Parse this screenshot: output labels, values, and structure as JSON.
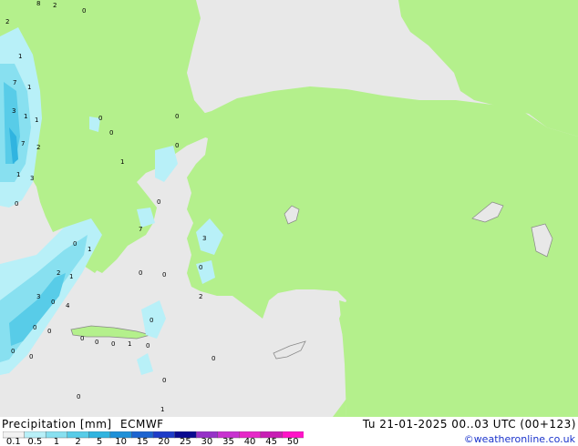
{
  "header": {
    "title": "Precipitation [mm]",
    "model": "ECMWF",
    "valid": "Tu 21-01-2025 00..03 UTC (00+123)"
  },
  "credit": "©weatheronline.co.uk",
  "legend": {
    "ticks": [
      "0.1",
      "0.5",
      "1",
      "2",
      "5",
      "10",
      "15",
      "20",
      "25",
      "30",
      "35",
      "40",
      "45",
      "50"
    ],
    "colors": [
      "#f2f2f2",
      "#b8f0f8",
      "#88e0f0",
      "#58cce8",
      "#30b4e0",
      "#1e90d8",
      "#1c64d0",
      "#1e3cc8",
      "#0a0a90",
      "#9632c8",
      "#c832d0",
      "#e628c8",
      "#c81eb4",
      "#ff14c8"
    ]
  },
  "map": {
    "colors": {
      "sea": "#e8e8e8",
      "land": "#b4f08c",
      "drizzle": "#b8f0f8",
      "light": "#88e0f0",
      "moderate": "#58cce8",
      "heavy": "#30b4e0",
      "intense": "#1e90d8"
    },
    "labels": [
      "2",
      "8",
      "1",
      "0",
      "2",
      "7",
      "1",
      "3",
      "1",
      "1",
      "7",
      "2",
      "1",
      "3",
      "0",
      "0",
      "0",
      "0",
      "0",
      "1",
      "0",
      "3",
      "7",
      "1",
      "0",
      "2",
      "1",
      "3",
      "0",
      "4",
      "0",
      "0",
      "0",
      "0",
      "0",
      "0",
      "0",
      "1",
      "0",
      "0",
      "0",
      "0",
      "0",
      "1",
      "0",
      "2",
      "0",
      "0"
    ]
  }
}
